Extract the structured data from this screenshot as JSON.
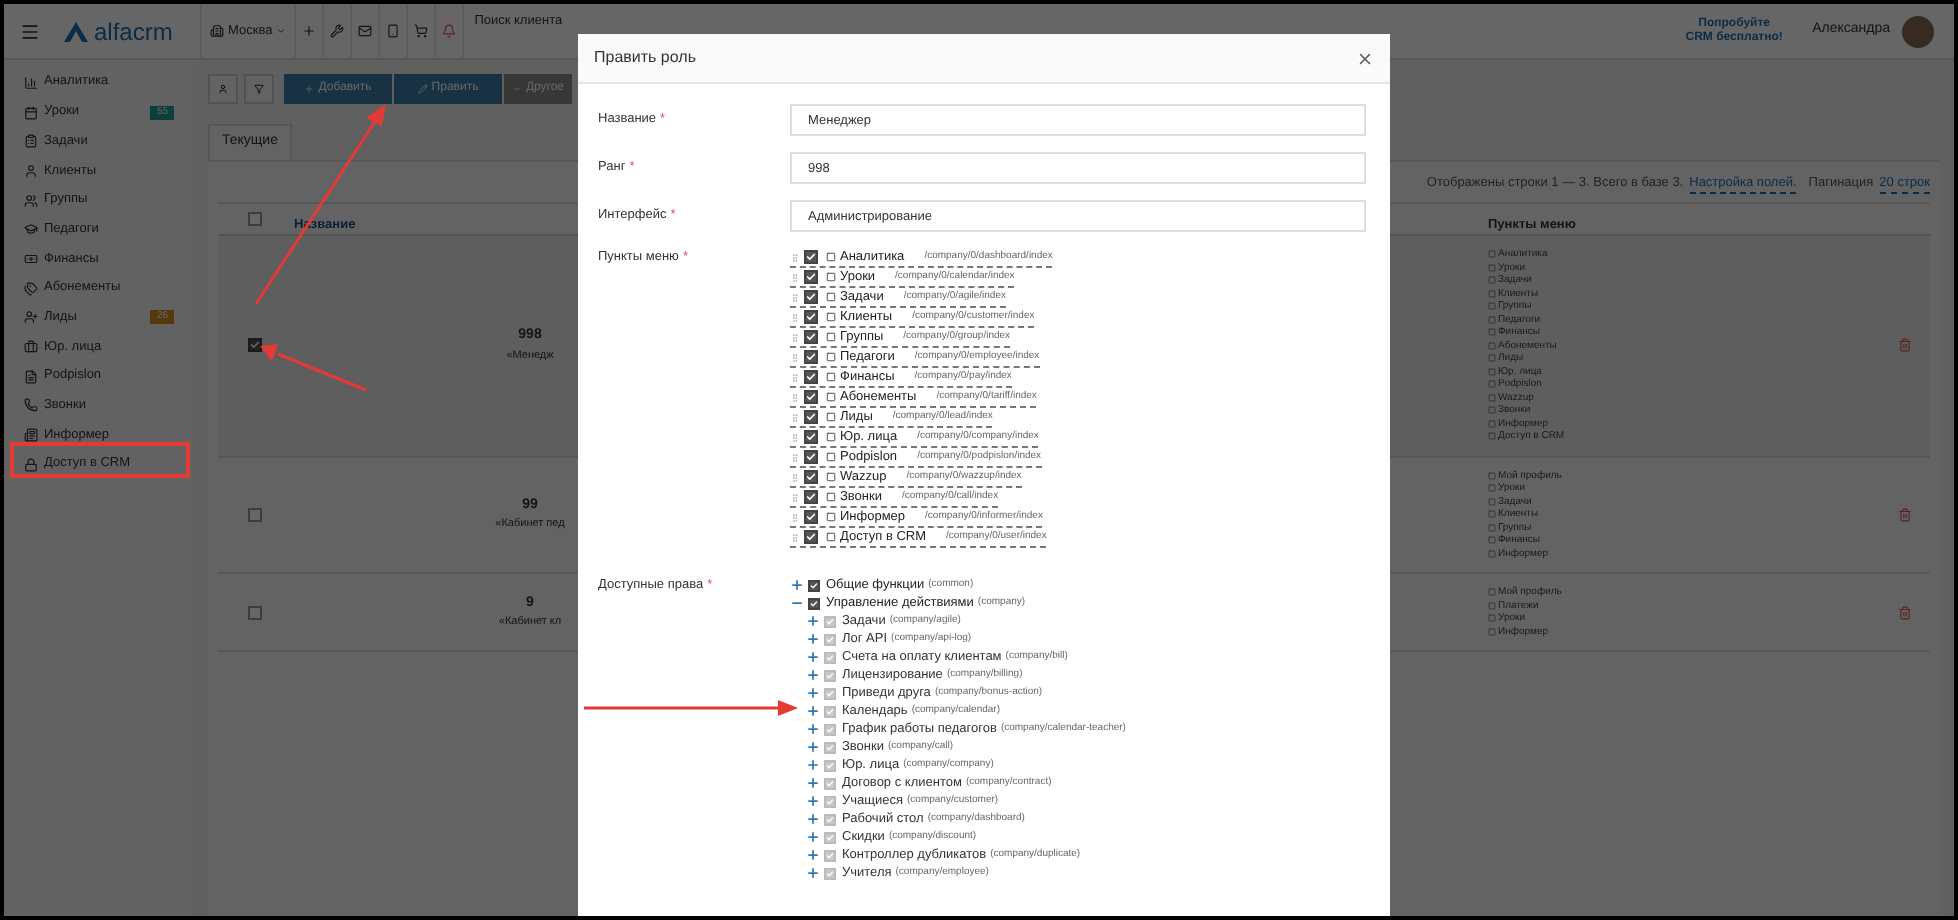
{
  "header": {
    "logo": "alfacrm",
    "city": "Москва",
    "search_placeholder": "Поиск клиента",
    "promo": "Попробуйте CRM бесплатно!",
    "user": "Александра"
  },
  "sidebar": {
    "items": [
      {
        "label": "Аналитика"
      },
      {
        "label": "Уроки",
        "badge": "55",
        "kind": "success"
      },
      {
        "label": "Задачи"
      },
      {
        "label": "Клиенты"
      },
      {
        "label": "Группы"
      },
      {
        "label": "Педагоги"
      },
      {
        "label": "Финансы"
      },
      {
        "label": "Абонементы"
      },
      {
        "label": "Лиды",
        "badge": "26",
        "kind": "warning"
      },
      {
        "label": "Юр. лица"
      },
      {
        "label": "Podpislon"
      },
      {
        "label": "Звонки"
      },
      {
        "label": "Информер"
      },
      {
        "label": "Доступ в CRM"
      }
    ]
  },
  "toolbar": {
    "buttons": [
      {
        "label": "Добавить",
        "kind": "primary"
      },
      {
        "label": "Править",
        "kind": "primary"
      },
      {
        "label": "Другое",
        "kind": "disabled"
      }
    ]
  },
  "tabs": [
    {
      "label": "Текущие",
      "selected": true
    }
  ],
  "info": {
    "text": "Отображены строки 1 — 3. Всего в базе 3.",
    "settings_link": "Настройка полей.",
    "pagination_label": "Пагинация",
    "pagination_link": "20 строк"
  },
  "table": {
    "columns": [
      "Название",
      "Пункты меню"
    ],
    "header_checked": false,
    "rows": [
      {
        "checked": true,
        "rank": "998",
        "name": "«Менедж",
        "menu": [
          "Аналитика",
          "Уроки",
          "Задачи",
          "Клиенты",
          "Группы",
          "Педагоги",
          "Финансы",
          "Абонементы",
          "Лиды",
          "Юр. лица",
          "Podpislon",
          "Wazzup",
          "Звонки",
          "Информер",
          "Доступ в CRM"
        ]
      },
      {
        "checked": false,
        "rank": "99",
        "name": "«Кабинет пед",
        "menu": [
          "Мой профиль",
          "Уроки",
          "Задачи",
          "Клиенты",
          "Группы",
          "Финансы",
          "Информер"
        ]
      },
      {
        "checked": false,
        "rank": "9",
        "name": "«Кабинет кл",
        "menu": [
          "Мой профиль",
          "Платежи",
          "Уроки",
          "Информер"
        ]
      }
    ]
  },
  "modal": {
    "title": "Править роль",
    "fields": [
      {
        "label": "Название",
        "mark": "*",
        "value": "Менеджер"
      },
      {
        "label": "Ранг",
        "mark": "*",
        "value": "998"
      },
      {
        "label": "Интерфейс",
        "mark": "*",
        "value": "Администрирование"
      }
    ],
    "menu_label": "Пункты меню",
    "menu_mark": "*",
    "menu_items": [
      {
        "label": "Аналитика",
        "path": "/company/0/dashboard/index",
        "checked": true
      },
      {
        "label": "Уроки",
        "path": "/company/0/calendar/index",
        "checked": true
      },
      {
        "label": "Задачи",
        "path": "/company/0/agile/index",
        "checked": true
      },
      {
        "label": "Клиенты",
        "path": "/company/0/customer/index",
        "checked": true
      },
      {
        "label": "Группы",
        "path": "/company/0/group/index",
        "checked": true
      },
      {
        "label": "Педагоги",
        "path": "/company/0/employee/index",
        "checked": true
      },
      {
        "label": "Финансы",
        "path": "/company/0/pay/index",
        "checked": true
      },
      {
        "label": "Абонементы",
        "path": "/company/0/tariff/index",
        "checked": true
      },
      {
        "label": "Лиды",
        "path": "/company/0/lead/index",
        "checked": true
      },
      {
        "label": "Юр. лица",
        "path": "/company/0/company/index",
        "checked": true
      },
      {
        "label": "Podpislon",
        "path": "/company/0/podpislon/index",
        "checked": true
      },
      {
        "label": "Wazzup",
        "path": "/company/0/wazzup/index",
        "checked": true
      },
      {
        "label": "Звонки",
        "path": "/company/0/call/index",
        "checked": true
      },
      {
        "label": "Информер",
        "path": "/company/0/informer/index",
        "checked": true
      },
      {
        "label": "Доступ в CRM",
        "path": "/company/0/user/index",
        "checked": true
      }
    ],
    "rights_label": "Доступные права",
    "rights_mark": "*",
    "rights": [
      {
        "label": "Общие функции",
        "code": "(common)",
        "checked": true,
        "disabled": false,
        "expanded": false
      },
      {
        "label": "Управление действиями",
        "code": "(company)",
        "checked": true,
        "disabled": false,
        "expanded": true,
        "children": [
          {
            "label": "Задачи",
            "code": "(company/agile)",
            "checked": true,
            "disabled": true,
            "expanded": false
          },
          {
            "label": "Лог API",
            "code": "(company/api-log)",
            "checked": true,
            "disabled": true,
            "expanded": false
          },
          {
            "label": "Счета на оплату клиентам",
            "code": "(company/bill)",
            "checked": true,
            "disabled": true,
            "expanded": false
          },
          {
            "label": "Лицензирование",
            "code": "(company/billing)",
            "checked": true,
            "disabled": true,
            "expanded": false
          },
          {
            "label": "Приведи друга",
            "code": "(company/bonus-action)",
            "checked": true,
            "disabled": true,
            "expanded": false
          },
          {
            "label": "Календарь",
            "code": "(company/calendar)",
            "checked": true,
            "disabled": true,
            "expanded": false
          },
          {
            "label": "График работы педагогов",
            "code": "(company/calendar-teacher)",
            "checked": true,
            "disabled": true,
            "expanded": false
          },
          {
            "label": "Звонки",
            "code": "(company/call)",
            "checked": true,
            "disabled": true,
            "expanded": false
          },
          {
            "label": "Юр. лица",
            "code": "(company/company)",
            "checked": true,
            "disabled": true,
            "expanded": false
          },
          {
            "label": "Договор с клиентом",
            "code": "(company/contract)",
            "checked": true,
            "disabled": true,
            "expanded": false
          },
          {
            "label": "Учащиеся",
            "code": "(company/customer)",
            "checked": true,
            "disabled": true,
            "expanded": false
          },
          {
            "label": "Рабочий стол",
            "code": "(company/dashboard)",
            "checked": true,
            "disabled": true,
            "expanded": false
          },
          {
            "label": "Скидки",
            "code": "(company/discount)",
            "checked": true,
            "disabled": true,
            "expanded": false
          },
          {
            "label": "Контроллер дубликатов",
            "code": "(company/duplicate)",
            "checked": true,
            "disabled": true,
            "expanded": false
          },
          {
            "label": "Учителя",
            "code": "(company/employee)",
            "checked": true,
            "disabled": true,
            "expanded": false
          }
        ]
      }
    ]
  }
}
